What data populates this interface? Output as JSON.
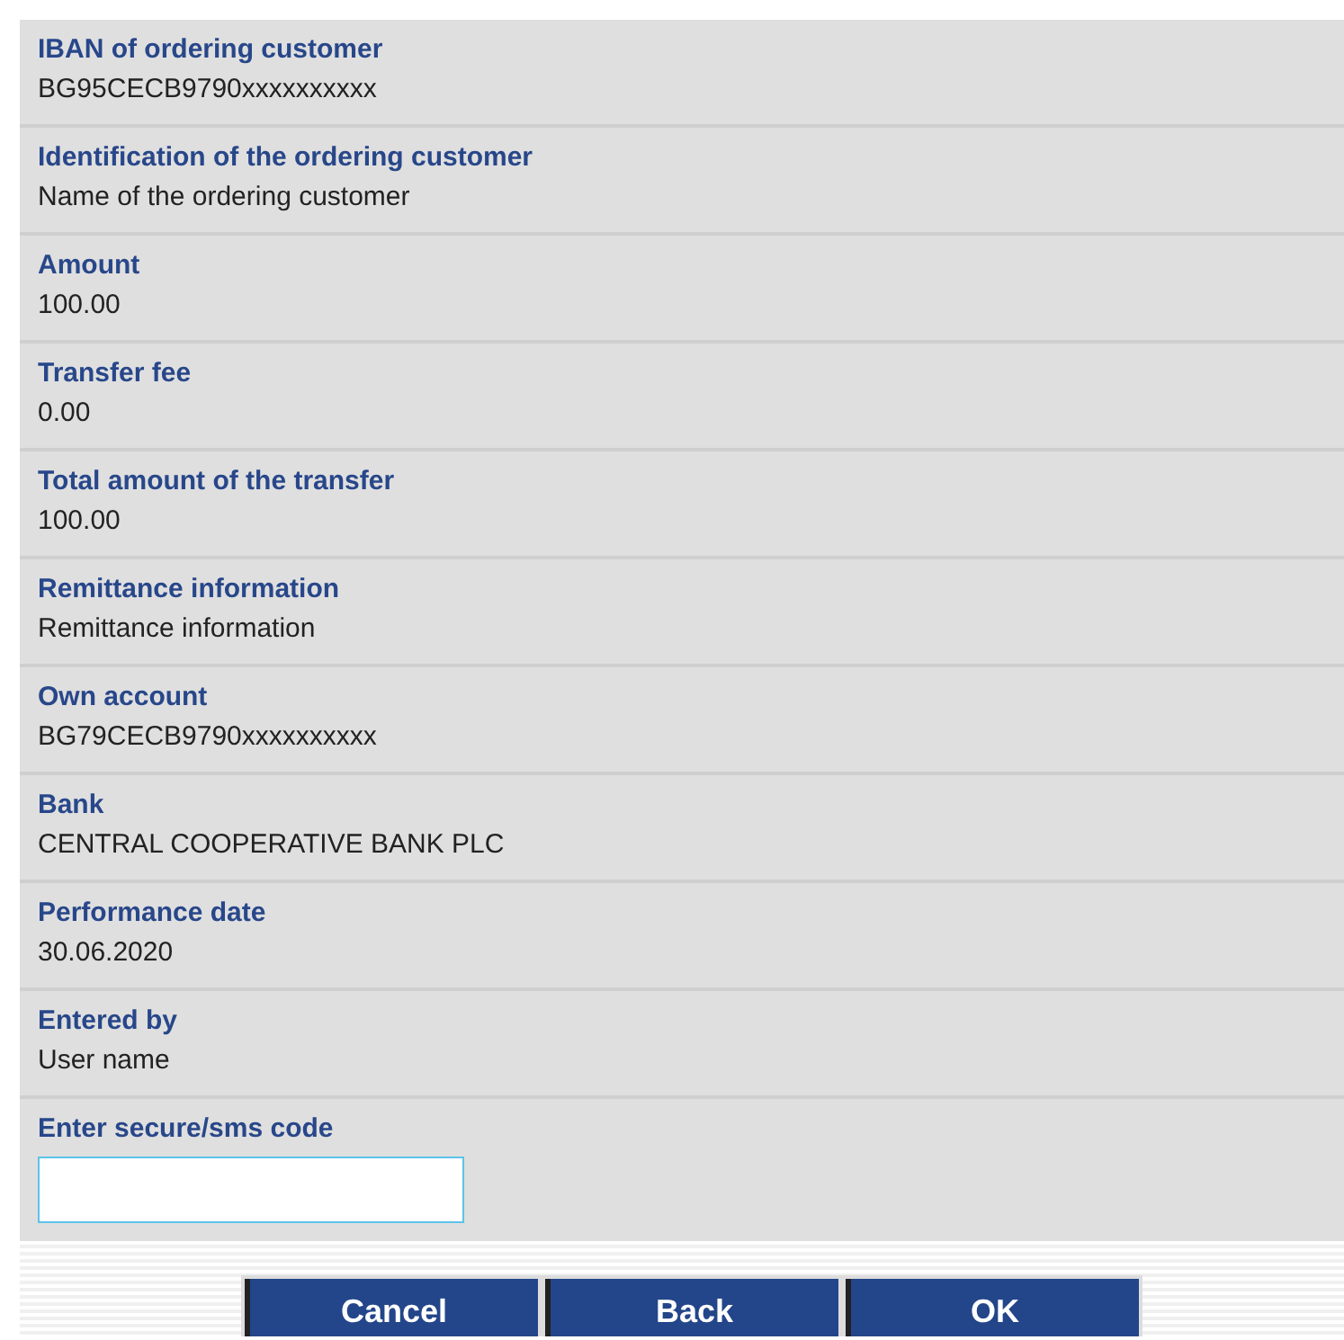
{
  "fields": [
    {
      "label": "IBAN of ordering customer",
      "value": "BG95CECB9790xxxxxxxxxx"
    },
    {
      "label": "Identification of the ordering customer",
      "value": "Name of the ordering customer"
    },
    {
      "label": "Amount",
      "value": "100.00"
    },
    {
      "label": "Transfer fee",
      "value": "0.00"
    },
    {
      "label": "Total amount of the transfer",
      "value": "100.00"
    },
    {
      "label": "Remittance information",
      "value": "Remittance information"
    },
    {
      "label": "Own account",
      "value": "BG79CECB9790xxxxxxxxxx"
    },
    {
      "label": "Bank",
      "value": "CENTRAL COOPERATIVE BANK PLC"
    },
    {
      "label": "Performance date",
      "value": "30.06.2020"
    },
    {
      "label": "Entered by",
      "value": "User name"
    }
  ],
  "code_field": {
    "label": "Enter secure/sms code"
  },
  "buttons": [
    "Cancel",
    "Back",
    "OK"
  ]
}
